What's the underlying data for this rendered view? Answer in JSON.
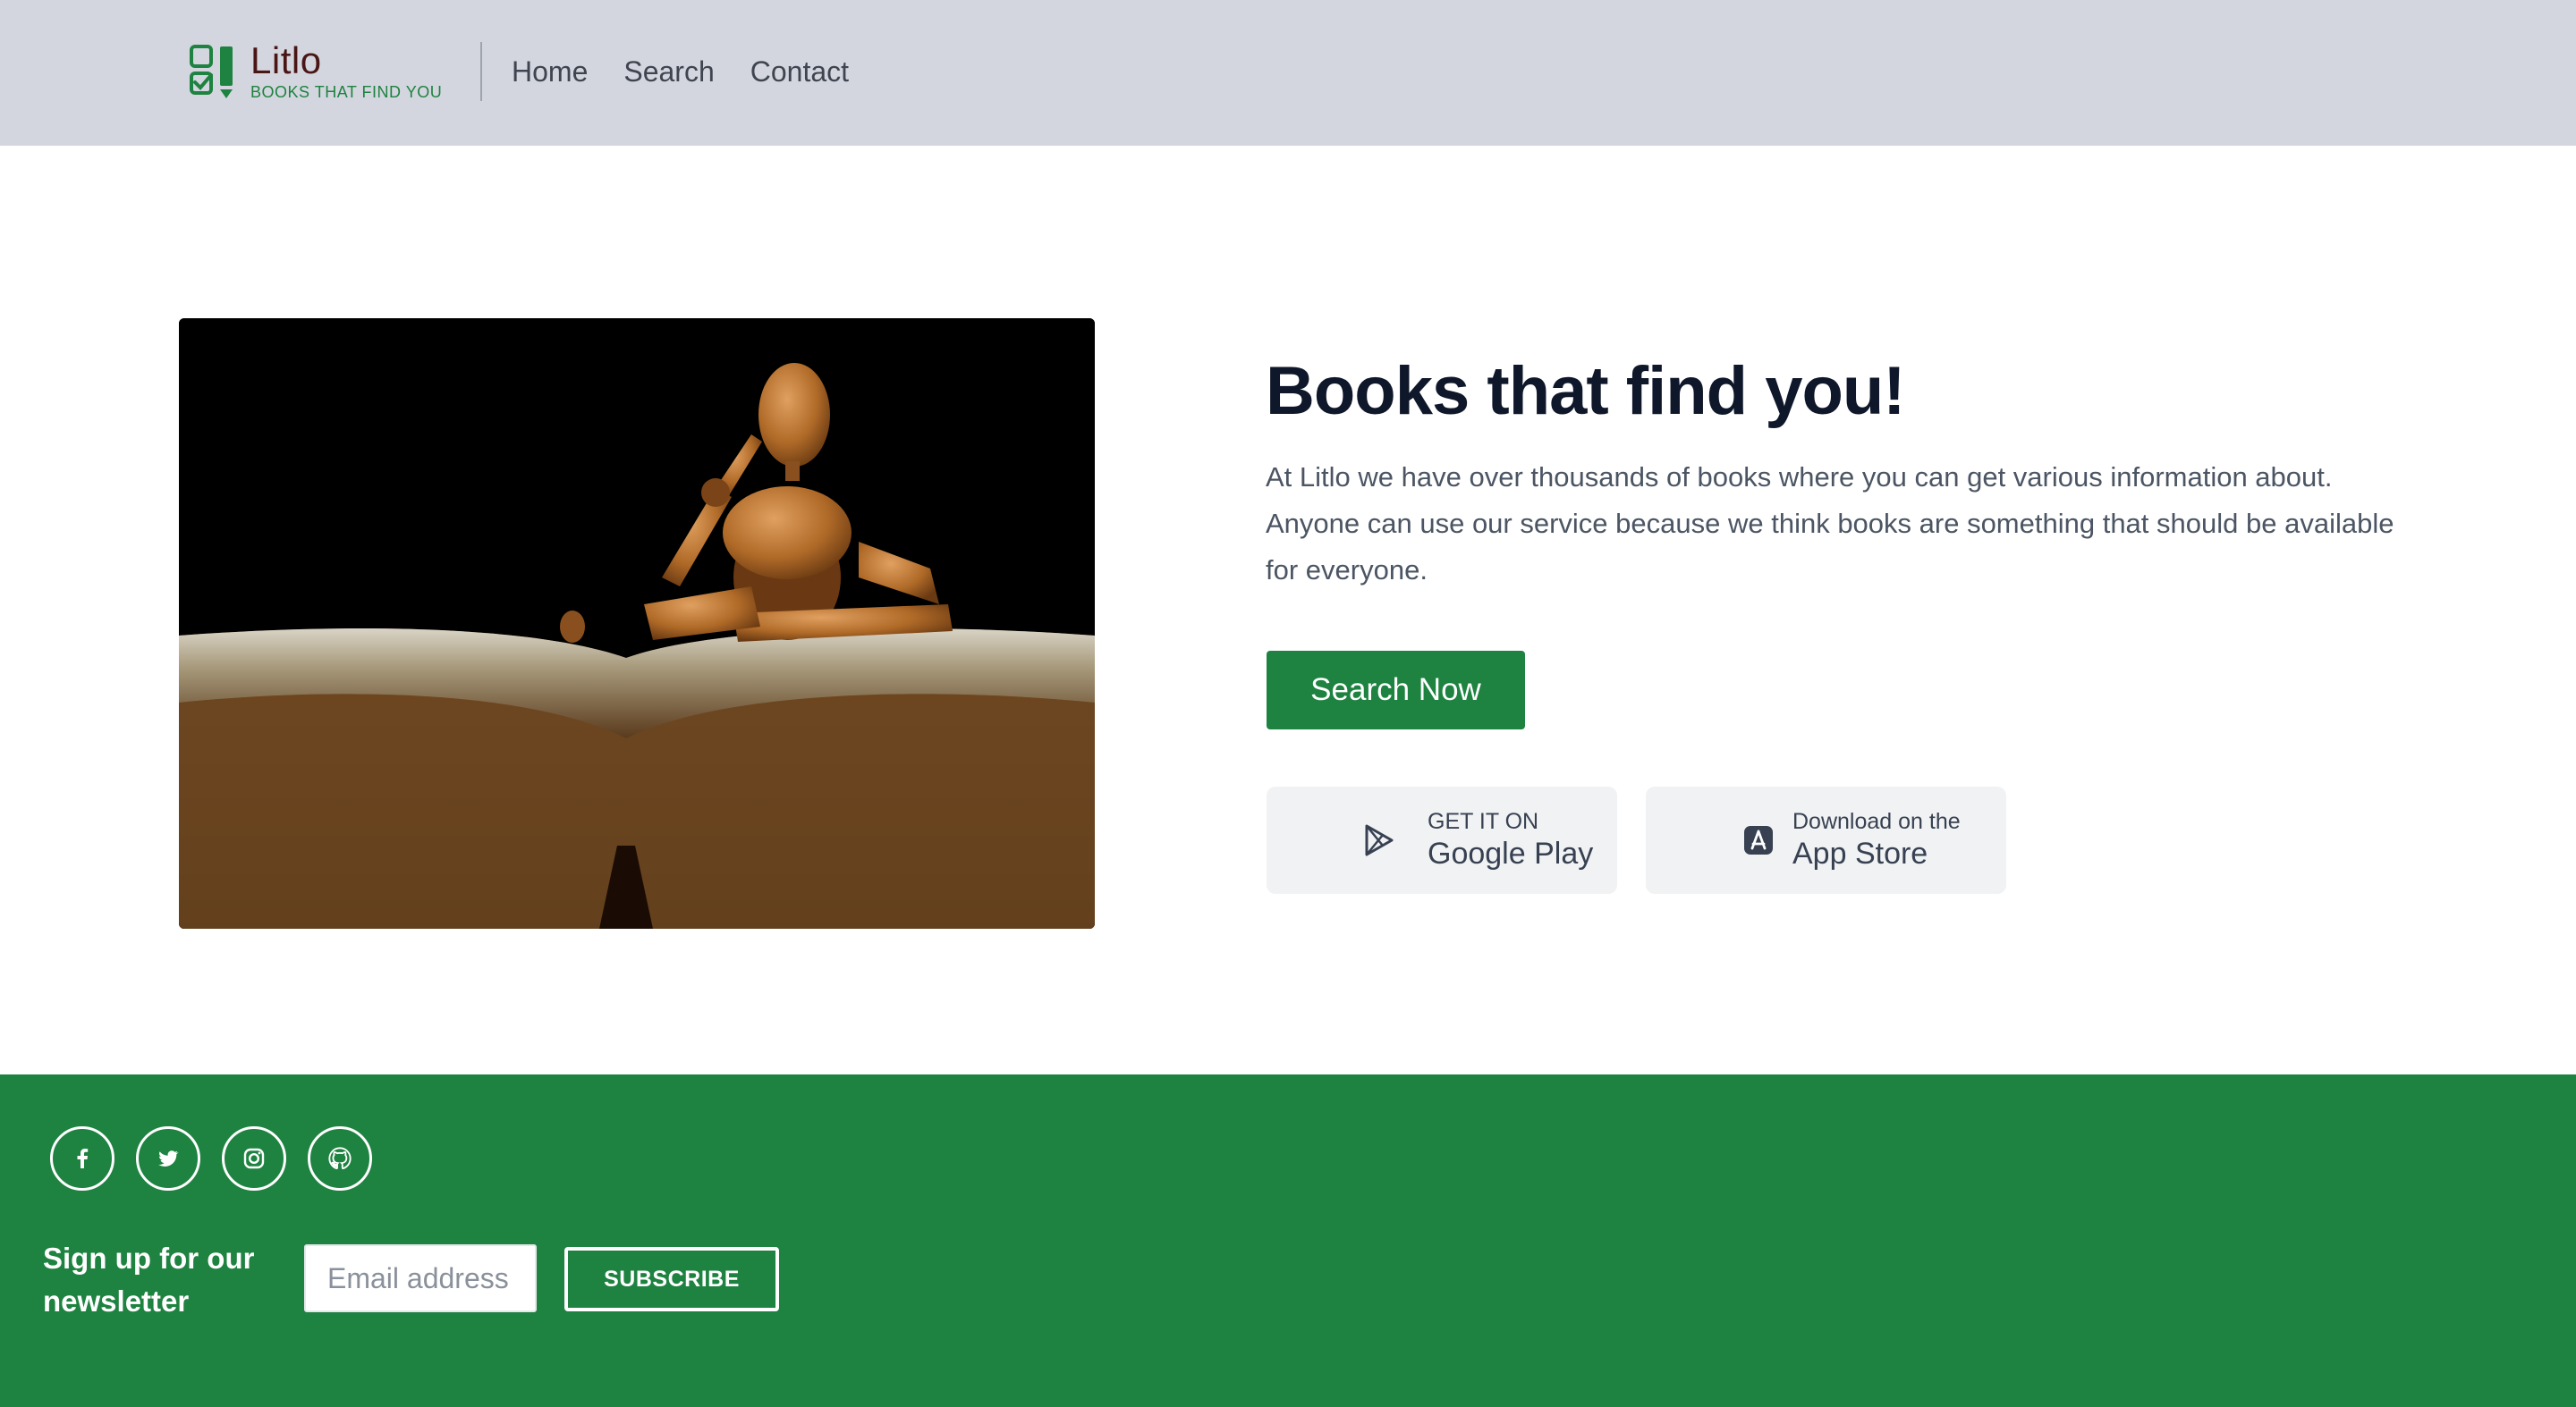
{
  "header": {
    "brand_name": "Litlo",
    "brand_tagline": "BOOKS THAT FIND YOU",
    "logo_icon": "checklist-pencil-icon",
    "nav": [
      {
        "label": "Home"
      },
      {
        "label": "Search"
      },
      {
        "label": "Contact"
      }
    ]
  },
  "hero": {
    "image_alt": "wooden mannequin sitting on open book",
    "title": "Books that find you!",
    "description": "At Litlo we have over thousands of books where you can get various information about. Anyone can use our service because we think books are something that should be available for everyone.",
    "cta_label": "Search Now",
    "google_play": {
      "small": "GET IT ON",
      "big": "Google Play",
      "icon": "play-store-icon"
    },
    "app_store": {
      "small": "Download on the",
      "big": "App Store",
      "icon": "app-store-icon"
    }
  },
  "footer": {
    "social": [
      {
        "name": "facebook",
        "icon": "facebook-icon"
      },
      {
        "name": "twitter",
        "icon": "twitter-icon"
      },
      {
        "name": "instagram",
        "icon": "instagram-icon"
      },
      {
        "name": "github",
        "icon": "github-icon"
      }
    ],
    "newsletter_label": "Sign up for our newsletter",
    "email_placeholder": "Email address",
    "email_value": "",
    "subscribe_label": "SUBSCRIBE"
  },
  "colors": {
    "header_bg": "#d3d6de",
    "brand_green": "#1e8240",
    "brand_dark": "#4a1515",
    "title": "#0f172a",
    "body_text": "#4b5563"
  }
}
